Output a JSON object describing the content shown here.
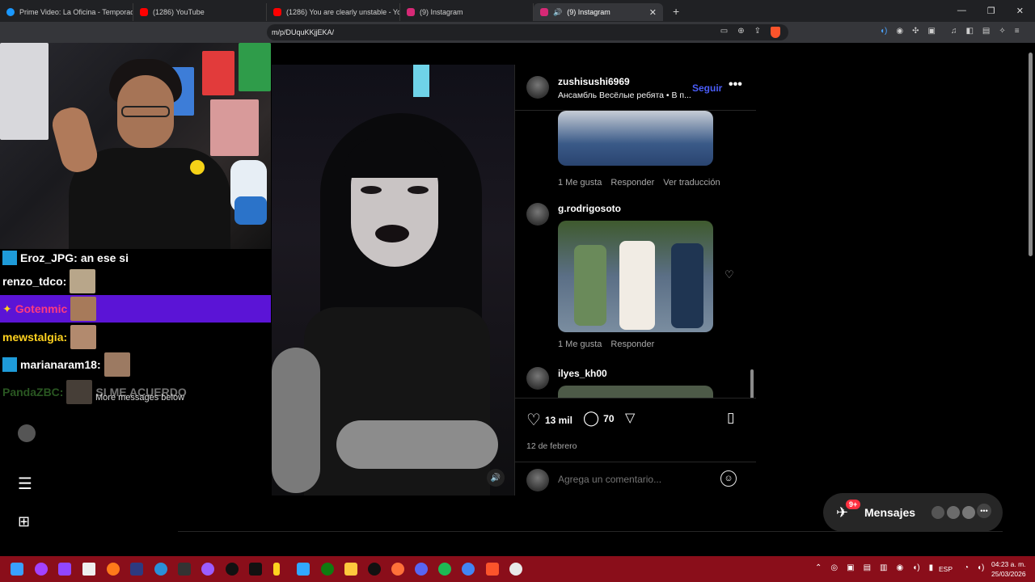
{
  "browser": {
    "tabs": [
      {
        "label": "Prime Video: La Oficina - Temporada",
        "color": "#1a98ff"
      },
      {
        "label": "(1286) YouTube",
        "color": "#ff0000"
      },
      {
        "label": "(1286) You are clearly unstable - You",
        "color": "#ff0000"
      },
      {
        "label": "(9) Instagram",
        "color": "#d62976"
      },
      {
        "label": "(9) Instagram",
        "color": "#d62976",
        "active": true
      }
    ],
    "new_tab": "+",
    "url": "m/p/DUquKKjjEKA/",
    "window_controls": [
      "—",
      "❐",
      "✕"
    ]
  },
  "stream_chat": {
    "lines": [
      {
        "user": "Eroz_JPG:",
        "text": "an ese si",
        "color": "#ffffff"
      },
      {
        "user": "renzo_tdco:",
        "text": "",
        "color": "#ffffff"
      },
      {
        "user": "Gotenmic",
        "text": "",
        "color": "#ff3b7f"
      },
      {
        "user": "mewstalgia:",
        "text": "",
        "color": "#ffd21f"
      },
      {
        "user": "marianaram18:",
        "text": "",
        "color": "#ffffff"
      },
      {
        "user": "PandaZBC:",
        "text": "SI ME ACUERDO",
        "color": "#5bbf4a"
      }
    ],
    "more_messages": "More messages below"
  },
  "post": {
    "header": {
      "username": "zushisushi6969",
      "subtitle": "Ансамбль Весёлые ребята • В п...",
      "follow": "Seguir",
      "more": "•••"
    },
    "comments": [
      {
        "username": "",
        "likes": "1 Me gusta",
        "reply": "Responder",
        "translate": "Ver traducción"
      },
      {
        "username": "g.rodrigosoto",
        "likes": "1 Me gusta",
        "reply": "Responder"
      },
      {
        "username": "ilyes_kh00"
      }
    ],
    "likes": "13 mil",
    "comments_count": "70",
    "date": "12 de febrero",
    "comment_placeholder": "Agrega un comentario..."
  },
  "messages": {
    "label": "Mensajes",
    "badge": "9+"
  },
  "taskbar": {
    "lang": "ESP",
    "time": "04:23 a. m.",
    "date": "25/03/2026"
  }
}
